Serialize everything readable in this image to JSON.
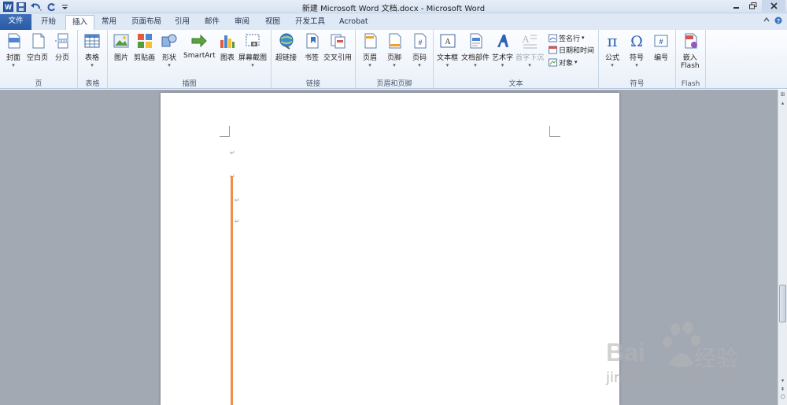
{
  "window": {
    "title": "新建 Microsoft Word 文档.docx - Microsoft Word"
  },
  "tabs": [
    "文件",
    "开始",
    "插入",
    "常用",
    "页面布局",
    "引用",
    "邮件",
    "审阅",
    "视图",
    "开发工具",
    "Acrobat"
  ],
  "active_tab": "插入",
  "ribbon": {
    "groups": {
      "page": {
        "label": "页",
        "cover": "封面",
        "blank": "空白页",
        "break": "分页"
      },
      "table": {
        "label": "表格",
        "table": "表格"
      },
      "illustrations": {
        "label": "插图",
        "picture": "图片",
        "clipart": "剪贴画",
        "shapes": "形状",
        "smartart": "SmartArt",
        "chart": "图表",
        "screenshot": "屏幕截图"
      },
      "links": {
        "label": "链接",
        "hyperlink": "超链接",
        "bookmark": "书签",
        "crossref": "交叉引用"
      },
      "header_footer": {
        "label": "页眉和页脚",
        "header": "页眉",
        "footer": "页脚",
        "pagenum": "页码"
      },
      "text": {
        "label": "文本",
        "textbox": "文本框",
        "quickparts": "文档部件",
        "wordart": "艺术字",
        "dropcap": "首字下沉",
        "signature": "签名行",
        "datetime": "日期和时间",
        "object": "对象"
      },
      "symbols": {
        "label": "符号",
        "equation": "公式",
        "symbol": "符号",
        "number": "编号"
      },
      "flash": {
        "label": "Flash",
        "embed_line1": "嵌入",
        "embed_line2": "Flash"
      }
    }
  },
  "document": {
    "paragraph_mark": "↵"
  },
  "watermark": {
    "brand": "Bai",
    "brand_cn": "经验",
    "url": "jingyan.baidu.com"
  },
  "colors": {
    "file_tab": "#2a5aa6",
    "accent_line": "#ee8e4a",
    "doc_background": "#a2a9b3"
  }
}
